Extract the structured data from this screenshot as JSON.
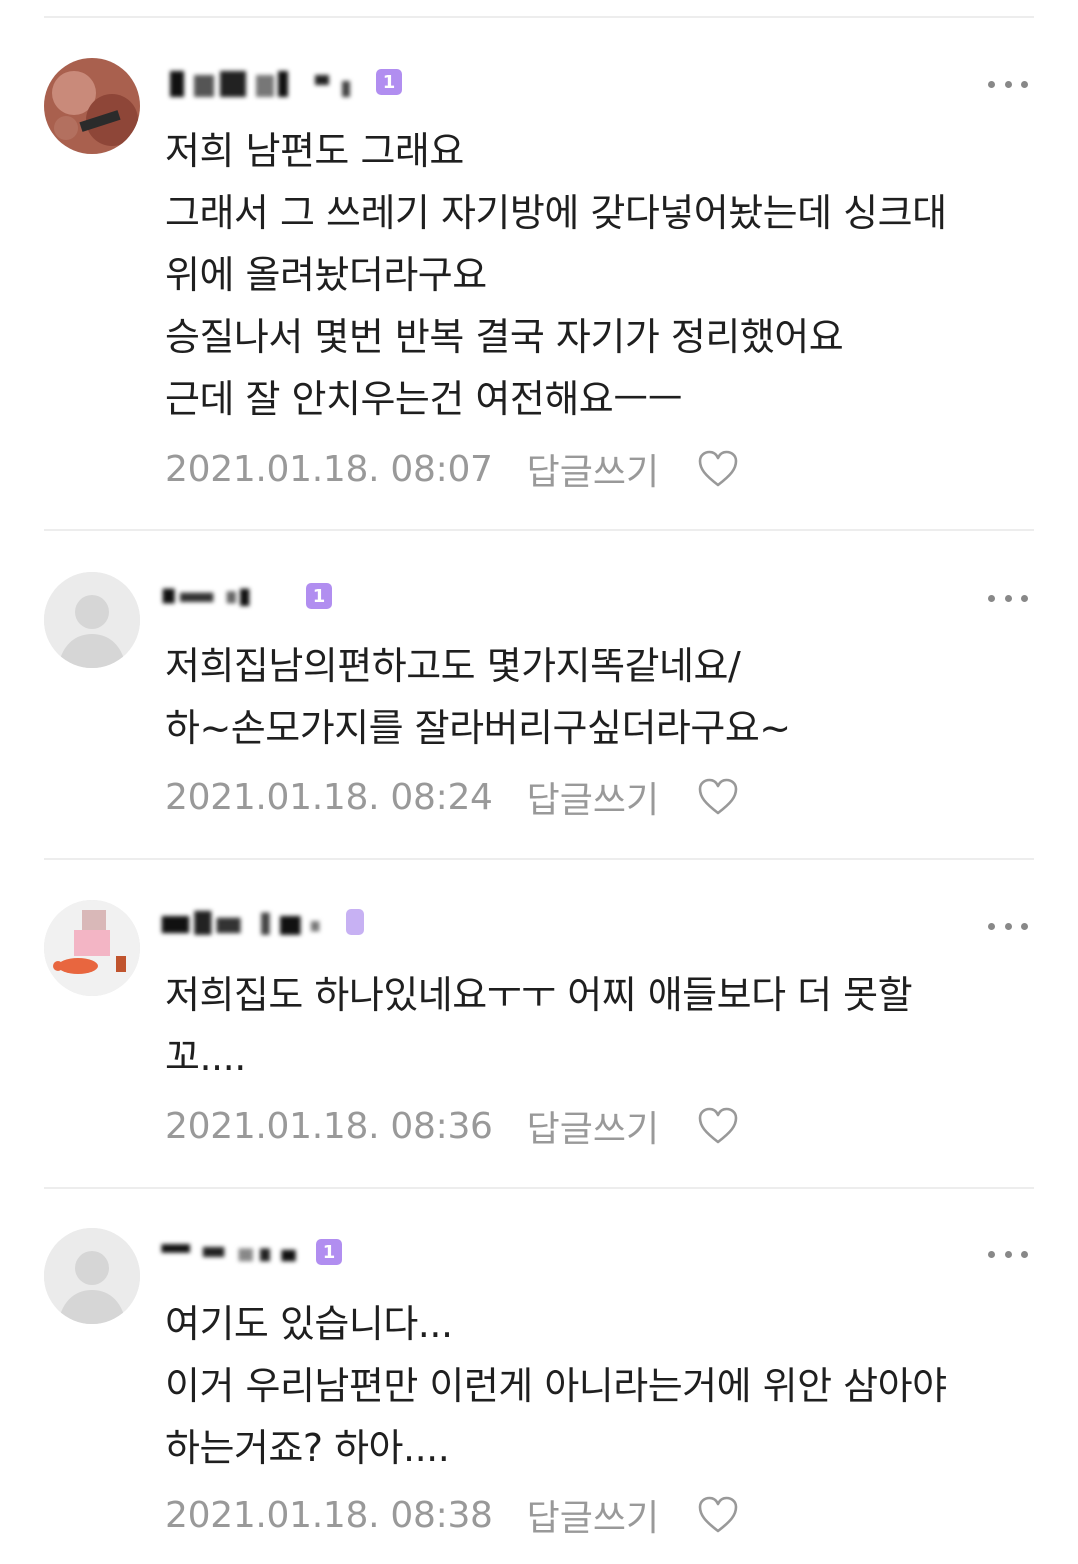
{
  "comments": [
    {
      "level": "1",
      "lines": [
        "저희 남편도 그래요",
        "그래서 그 쓰레기 자기방에 갖다넣어놨는데 싱크대",
        "위에 올려놨더라구요",
        "승질나서 몇번 반복 결국 자기가 정리했어요",
        "근데 잘 안치우는건 여전해요ㅡㅡ"
      ],
      "date": "2021.01.18. 08:07",
      "reply_label": "답글쓰기"
    },
    {
      "level": "1",
      "lines": [
        "저희집남의편하고도 몇가지똑같네요/",
        "하~손모가지를 잘라버리구싶더라구요~"
      ],
      "date": "2021.01.18. 08:24",
      "reply_label": "답글쓰기"
    },
    {
      "level": "",
      "lines": [
        "저희집도 하나있네요ㅜㅜ 어찌 애들보다 더 못할",
        "꼬...."
      ],
      "date": "2021.01.18. 08:36",
      "reply_label": "답글쓰기"
    },
    {
      "level": "1",
      "lines": [
        "여기도 있습니다...",
        "이거 우리남편만 이런게 아니라는거에 위안 삼아야",
        "하는거죠? 하아...."
      ],
      "date": "2021.01.18. 08:38",
      "reply_label": "답글쓰기"
    }
  ],
  "icons": {
    "more": "more-dots-icon",
    "like": "heart-outline-icon",
    "default_avatar": "default-profile-icon"
  },
  "colors": {
    "level_badge": "#b18ef0",
    "meta_text": "#999999",
    "divider": "#ededed"
  }
}
